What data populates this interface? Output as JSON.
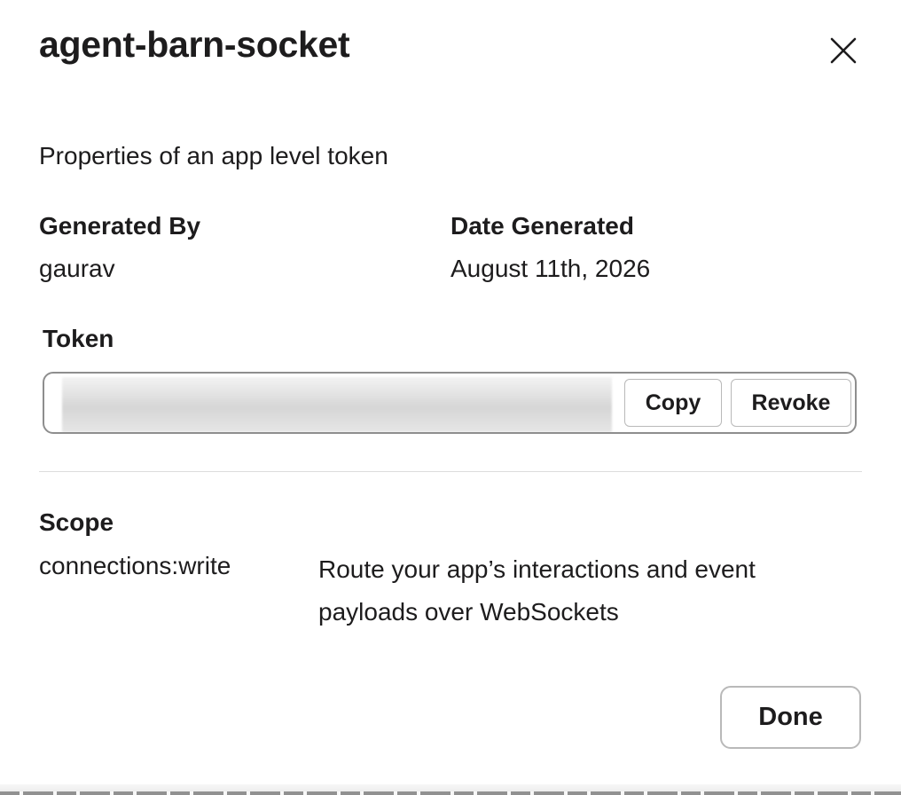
{
  "modal": {
    "title": "agent-barn-socket",
    "subtitle": "Properties of an app level token"
  },
  "generated_by": {
    "label": "Generated By",
    "value": "gaurav"
  },
  "date_generated": {
    "label": "Date Generated",
    "value": "August 11th, 2026"
  },
  "token": {
    "label": "Token",
    "copy_label": "Copy",
    "revoke_label": "Revoke"
  },
  "scope": {
    "label": "Scope",
    "items": [
      {
        "name": "connections:write",
        "description": "Route your app’s interactions and event payloads over WebSockets"
      }
    ]
  },
  "footer": {
    "done_label": "Done"
  },
  "icons": {
    "close": "close-icon"
  }
}
